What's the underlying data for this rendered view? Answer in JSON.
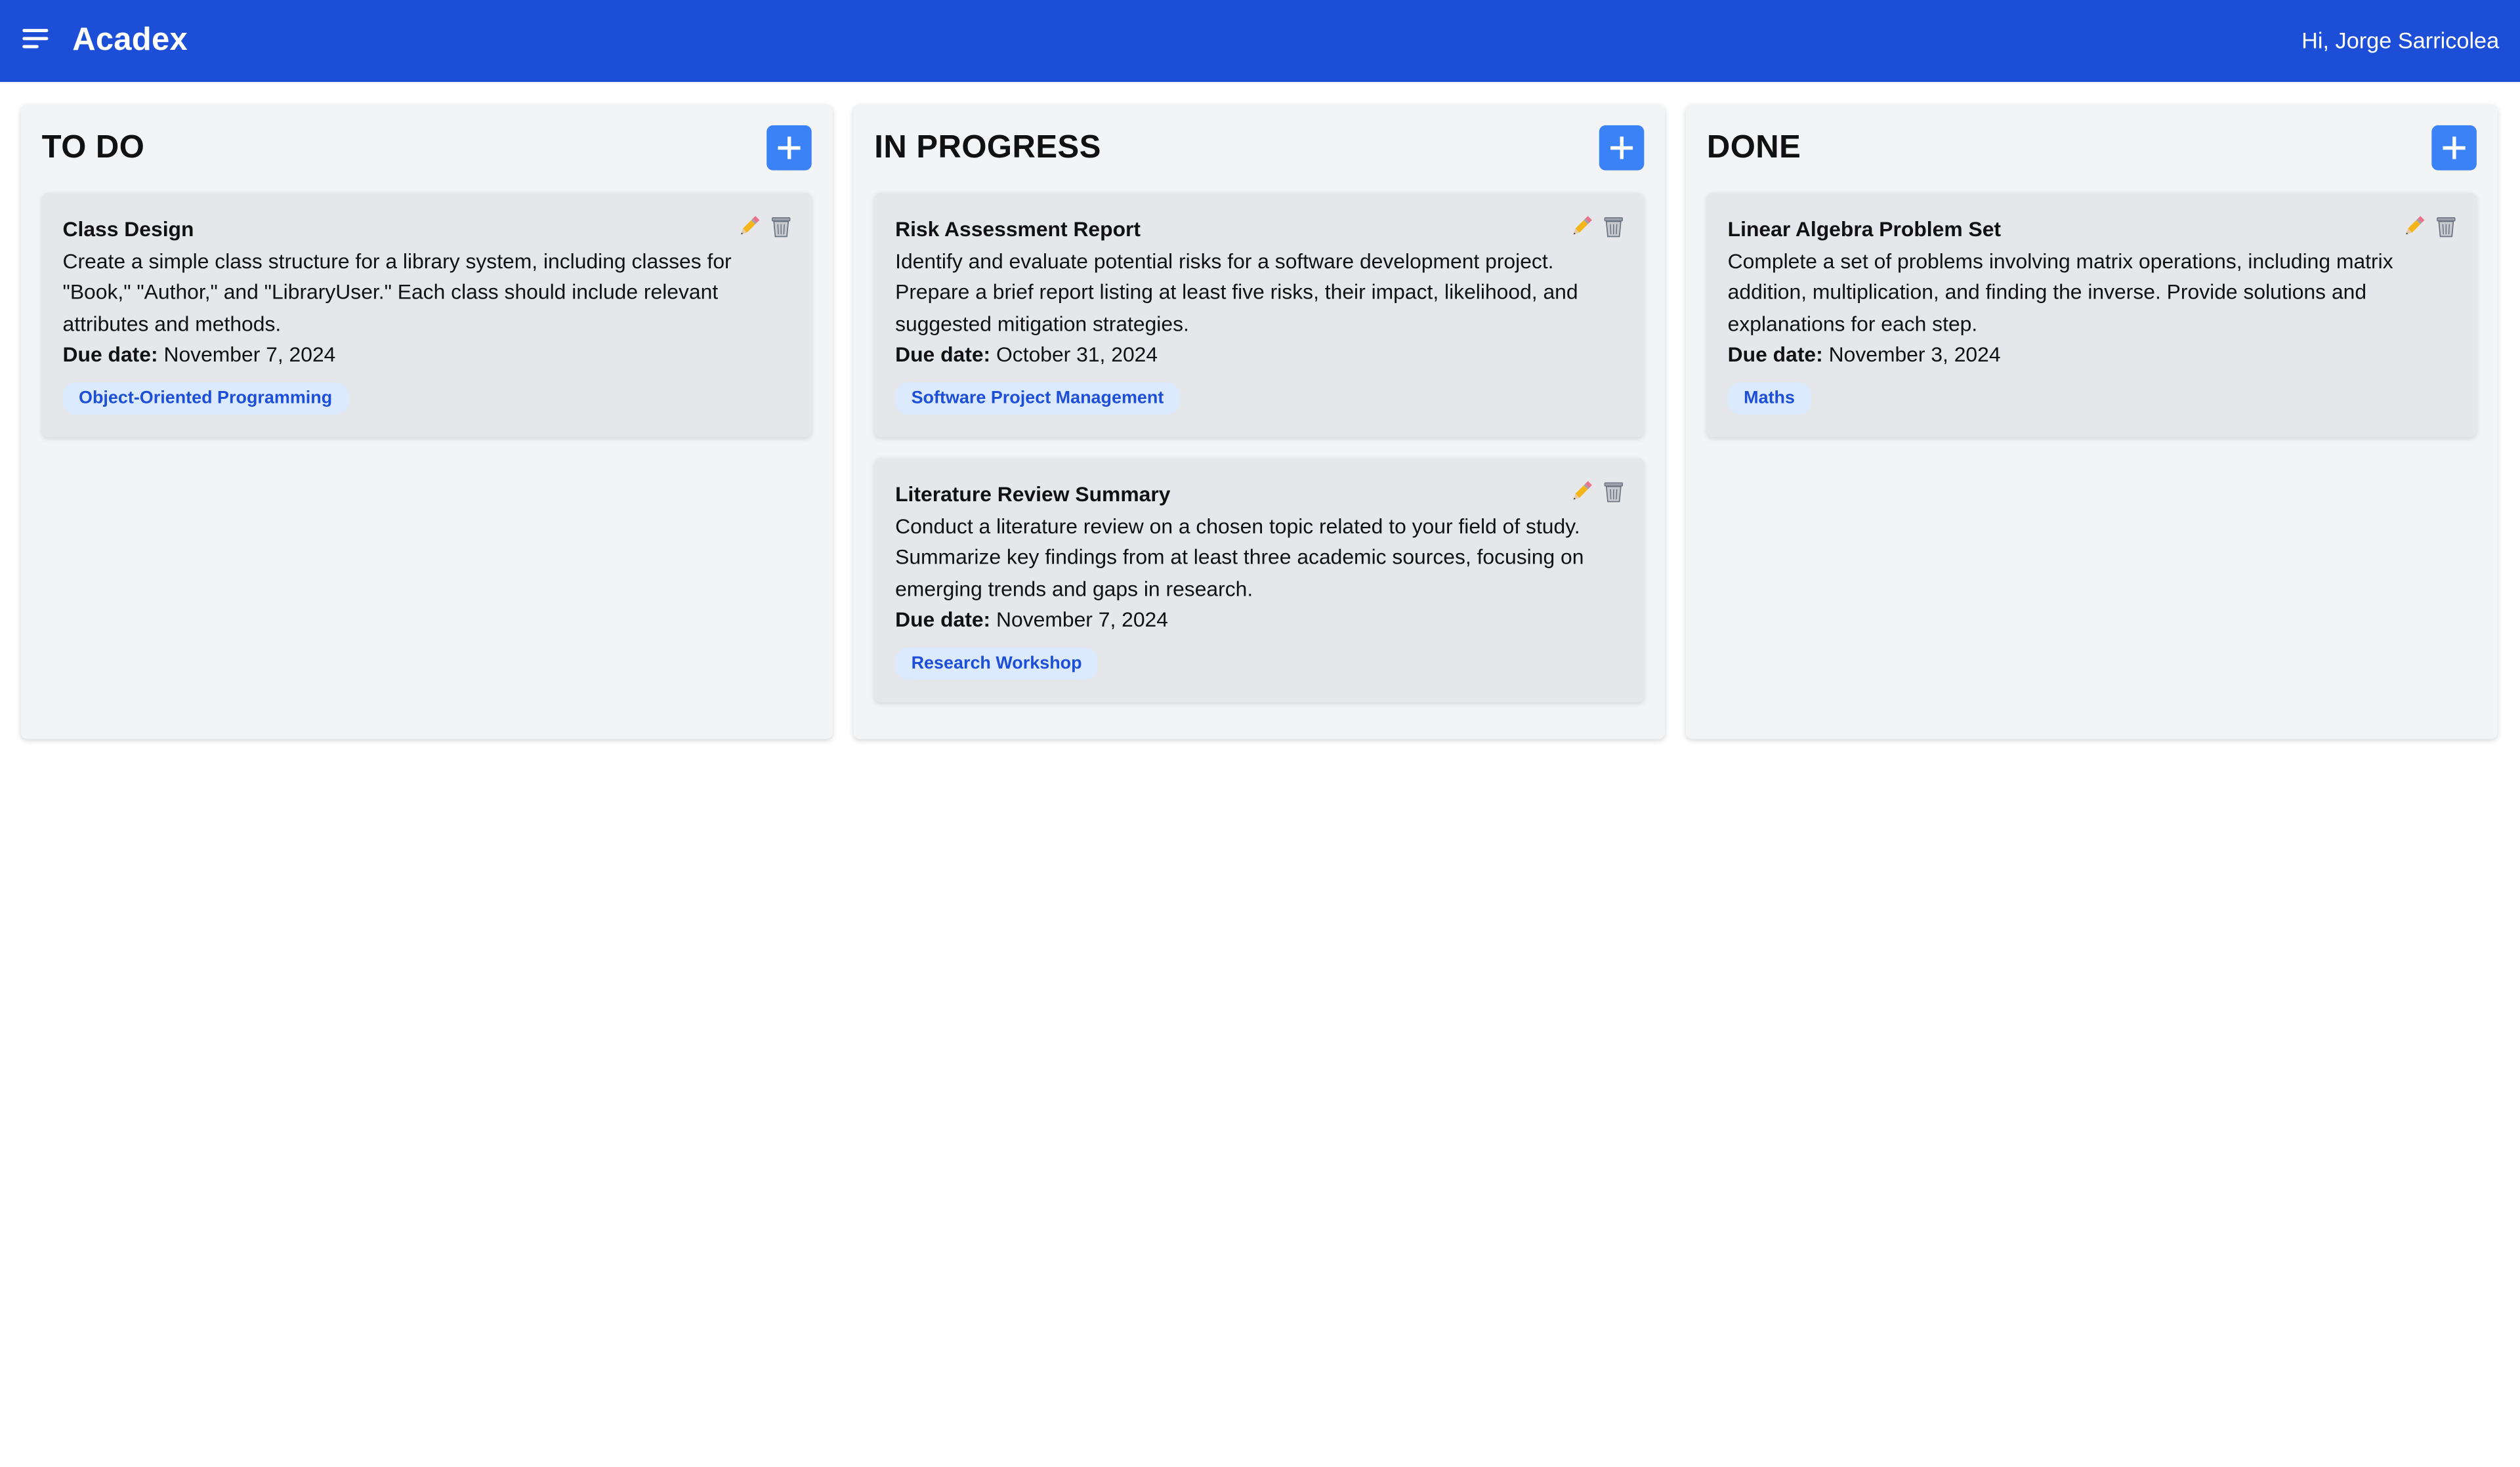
{
  "app": {
    "brand": "Acadex",
    "greeting": "Hi, Jorge Sarricolea",
    "accent_color": "#1d4ed8",
    "button_color": "#3b82f6"
  },
  "icons": {
    "menu": "hamburger-menu-icon",
    "add": "plus-icon",
    "edit": "pencil-icon",
    "delete": "trash-can-icon"
  },
  "due_label": "Due date:",
  "columns": [
    {
      "title": "TO DO",
      "cards": [
        {
          "title": "Class Design",
          "description": "Create a simple class structure for a library system, including classes for \"Book,\" \"Author,\" and \"LibraryUser.\" Each class should include relevant attributes and methods.",
          "due_date": "November 7, 2024",
          "tag": "Object-Oriented Programming"
        }
      ]
    },
    {
      "title": "IN PROGRESS",
      "cards": [
        {
          "title": "Risk Assessment Report",
          "description": "Identify and evaluate potential risks for a software development project. Prepare a brief report listing at least five risks, their impact, likelihood, and suggested mitigation strategies.",
          "due_date": "October 31, 2024",
          "tag": "Software Project Management"
        },
        {
          "title": "Literature Review Summary",
          "description": "Conduct a literature review on a chosen topic related to your field of study. Summarize key findings from at least three academic sources, focusing on emerging trends and gaps in research.",
          "due_date": "November 7, 2024",
          "tag": "Research Workshop"
        }
      ]
    },
    {
      "title": "DONE",
      "cards": [
        {
          "title": "Linear Algebra Problem Set",
          "description": "Complete a set of problems involving matrix operations, including matrix addition, multiplication, and finding the inverse. Provide solutions and explanations for each step.",
          "due_date": "November 3, 2024",
          "tag": "Maths"
        }
      ]
    }
  ]
}
